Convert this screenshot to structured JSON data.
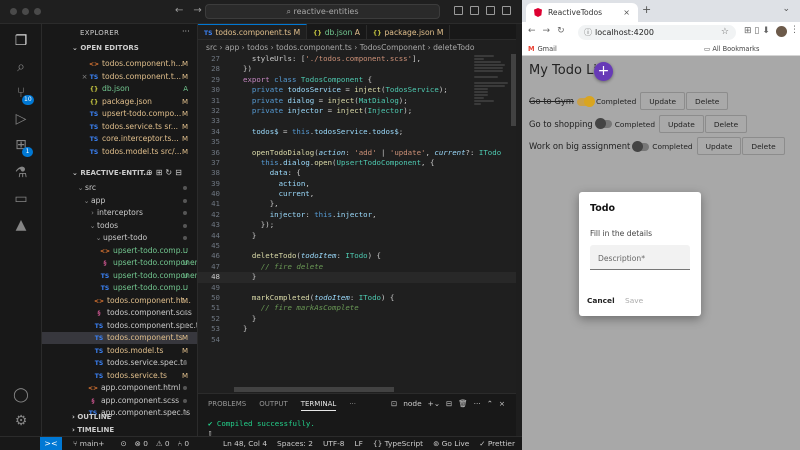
{
  "vscode": {
    "command_center": "reactive-entities",
    "activity_badges": {
      "scm": "10",
      "extensions": "1"
    },
    "explorer": {
      "title": "EXPLORER",
      "open_editors_label": "OPEN EDITORS",
      "open_editors": [
        {
          "name": "todos.component.h...",
          "status": "M",
          "icon": "html"
        },
        {
          "name": "todos.component.t...",
          "status": "M",
          "icon": "ts",
          "close": "×"
        },
        {
          "name": "db.json",
          "status": "A",
          "icon": "json"
        },
        {
          "name": "package.json",
          "status": "M",
          "icon": "json"
        },
        {
          "name": "upsert-todo.compo...",
          "status": "M",
          "icon": "ts"
        },
        {
          "name": "todos.service.ts sr...",
          "status": "M",
          "icon": "ts"
        },
        {
          "name": "core.interceptor.ts...",
          "status": "M",
          "icon": "ts"
        },
        {
          "name": "todos.model.ts src/...",
          "status": "M",
          "icon": "ts"
        }
      ],
      "project_label": "REACTIVE-ENTIT...",
      "tree": [
        {
          "name": "src",
          "indent": 0,
          "folder": true
        },
        {
          "name": "app",
          "indent": 1,
          "folder": true
        },
        {
          "name": "interceptors",
          "indent": 2,
          "folder": true,
          "collapsed": true
        },
        {
          "name": "todos",
          "indent": 2,
          "folder": true
        },
        {
          "name": "upsert-todo",
          "indent": 3,
          "folder": true
        },
        {
          "name": "upsert-todo.comp...",
          "indent": 4,
          "icon": "html",
          "status": "U"
        },
        {
          "name": "upsert-todo.component...",
          "indent": 4,
          "icon": "scss",
          "status": "U"
        },
        {
          "name": "upsert-todo.component....",
          "indent": 4,
          "icon": "ts",
          "status": "U"
        },
        {
          "name": "upsert-todo.comp...",
          "indent": 4,
          "icon": "ts",
          "status": "U"
        },
        {
          "name": "todos.component.ht...",
          "indent": 3,
          "icon": "html",
          "status": "M"
        },
        {
          "name": "todos.component.scss",
          "indent": 3,
          "icon": "scss"
        },
        {
          "name": "todos.component.spec.ts",
          "indent": 3,
          "icon": "ts"
        },
        {
          "name": "todos.component.ts",
          "indent": 3,
          "icon": "ts",
          "status": "M",
          "selected": true
        },
        {
          "name": "todos.model.ts",
          "indent": 3,
          "icon": "ts",
          "status": "M"
        },
        {
          "name": "todos.service.spec.ts",
          "indent": 3,
          "icon": "ts"
        },
        {
          "name": "todos.service.ts",
          "indent": 3,
          "icon": "ts",
          "status": "M"
        },
        {
          "name": "app.component.html",
          "indent": 2,
          "icon": "html"
        },
        {
          "name": "app.component.scss",
          "indent": 2,
          "icon": "scss"
        },
        {
          "name": "app.component.spec.ts",
          "indent": 2,
          "icon": "ts"
        }
      ],
      "outline_label": "OUTLINE",
      "timeline_label": "TIMELINE"
    },
    "tabs": [
      {
        "label": "todos.component.ts",
        "status": "M",
        "active": true,
        "icon": "TS"
      },
      {
        "label": "db.json",
        "status": "A",
        "icon": "{}"
      },
      {
        "label": "package.json",
        "status": "M",
        "icon": "{}"
      }
    ],
    "breadcrumb": [
      "src",
      "app",
      "todos",
      "todos.component.ts",
      "TodosComponent",
      "deleteTodo"
    ],
    "code_lines": [
      {
        "n": "27",
        "html": "  styleUrls: [<span class=\"s\">'./todos.component.scss'</span>],"
      },
      {
        "n": "28",
        "html": "})"
      },
      {
        "n": "29",
        "html": "<span class=\"kc\">export</span> <span class=\"k\">class</span> <span class=\"t\">TodosComponent</span> {"
      },
      {
        "n": "30",
        "html": "  <span class=\"k\">private</span> <span class=\"v\">todosService</span> = <span class=\"f\">inject</span>(<span class=\"t\">TodosService</span>);"
      },
      {
        "n": "31",
        "html": "  <span class=\"k\">private</span> <span class=\"v\">dialog</span> = <span class=\"f\">inject</span>(<span class=\"t\">MatDialog</span>);"
      },
      {
        "n": "32",
        "html": "  <span class=\"k\">private</span> <span class=\"v\">injector</span> = <span class=\"f\">inject</span>(<span class=\"t\">Injector</span>);"
      },
      {
        "n": "33",
        "html": ""
      },
      {
        "n": "34",
        "html": "  <span class=\"v\">todos$</span> = <span class=\"k\">this</span>.<span class=\"v\">todosService</span>.<span class=\"v\">todos$</span>;"
      },
      {
        "n": "35",
        "html": ""
      },
      {
        "n": "36",
        "html": "  <span class=\"f\">openTodoDialog</span>(<span class=\"pi\">action</span>: <span class=\"s\">'add'</span> | <span class=\"s\">'update'</span>, <span class=\"pi\">current</span>?: <span class=\"t\">ITodo</span>"
      },
      {
        "n": "37",
        "html": "    <span class=\"k\">this</span>.<span class=\"v\">dialog</span>.<span class=\"f\">open</span>(<span class=\"t\">UpsertTodoComponent</span>, {"
      },
      {
        "n": "38",
        "html": "      <span class=\"v\">data</span>: {"
      },
      {
        "n": "39",
        "html": "        <span class=\"v\">action</span>,"
      },
      {
        "n": "40",
        "html": "        <span class=\"v\">current</span>,"
      },
      {
        "n": "41",
        "html": "      },"
      },
      {
        "n": "42",
        "html": "      <span class=\"v\">injector</span>: <span class=\"k\">this</span>.<span class=\"v\">injector</span>,"
      },
      {
        "n": "43",
        "html": "    });"
      },
      {
        "n": "44",
        "html": "  }"
      },
      {
        "n": "45",
        "html": ""
      },
      {
        "n": "46",
        "html": "  <span class=\"f\">deleteTodo</span>(<span class=\"pi\">todoItem</span>: <span class=\"t\">ITodo</span>) {"
      },
      {
        "n": "47",
        "html": "    <span class=\"c\">// fire delete</span>"
      },
      {
        "n": "48",
        "html": "  }",
        "current": true
      },
      {
        "n": "49",
        "html": ""
      },
      {
        "n": "50",
        "html": "  <span class=\"f\">markCompleted</span>(<span class=\"pi\">todoItem</span>: <span class=\"t\">ITodo</span>) {"
      },
      {
        "n": "51",
        "html": "    <span class=\"c\">// fire markAsComplete</span>"
      },
      {
        "n": "52",
        "html": "  }"
      },
      {
        "n": "53",
        "html": "}"
      },
      {
        "n": "54",
        "html": ""
      }
    ],
    "panel": {
      "tabs": [
        "PROBLEMS",
        "OUTPUT",
        "TERMINAL",
        "···"
      ],
      "active_tab": "TERMINAL",
      "terminal_name": "node",
      "terminal_lines": [
        "✔ Compiled successfully.",
        "▯"
      ]
    },
    "statusbar": {
      "remote": "><",
      "branch": "main+",
      "sync": "⊙",
      "errors": "⊗ 0",
      "warnings": "⚠ 0",
      "ports": "⑃ 0",
      "position": "Ln 48, Col 4",
      "spaces": "Spaces: 2",
      "encoding": "UTF-8",
      "eol": "LF",
      "language": "{} TypeScript",
      "golive": "⊚ Go Live",
      "prettier": "✓ Prettier",
      "bell": "🔔"
    }
  },
  "browser": {
    "tab_title": "ReactiveTodos",
    "tab_close": "×",
    "new_tab": "+",
    "url": "localhost:4200",
    "bookmarks": {
      "gmail": "Gmail",
      "all": "All Bookmarks"
    },
    "app": {
      "title": "My Todo List",
      "fab": "+",
      "completed_label": "Completed",
      "update_label": "Update",
      "delete_label": "Delete",
      "todos": [
        {
          "text": "Go to Gym",
          "done": true
        },
        {
          "text": "Go to shopping",
          "done": false
        },
        {
          "text": "Work on big assignment",
          "done": false
        }
      ],
      "dialog": {
        "title": "Todo",
        "subtitle": "Fill in the details",
        "placeholder": "Description*",
        "cancel": "Cancel",
        "save": "Save"
      }
    }
  },
  "colors": {
    "accent": "#0078d4",
    "fab": "#673ab7",
    "toggle_on": "#d9a520"
  }
}
